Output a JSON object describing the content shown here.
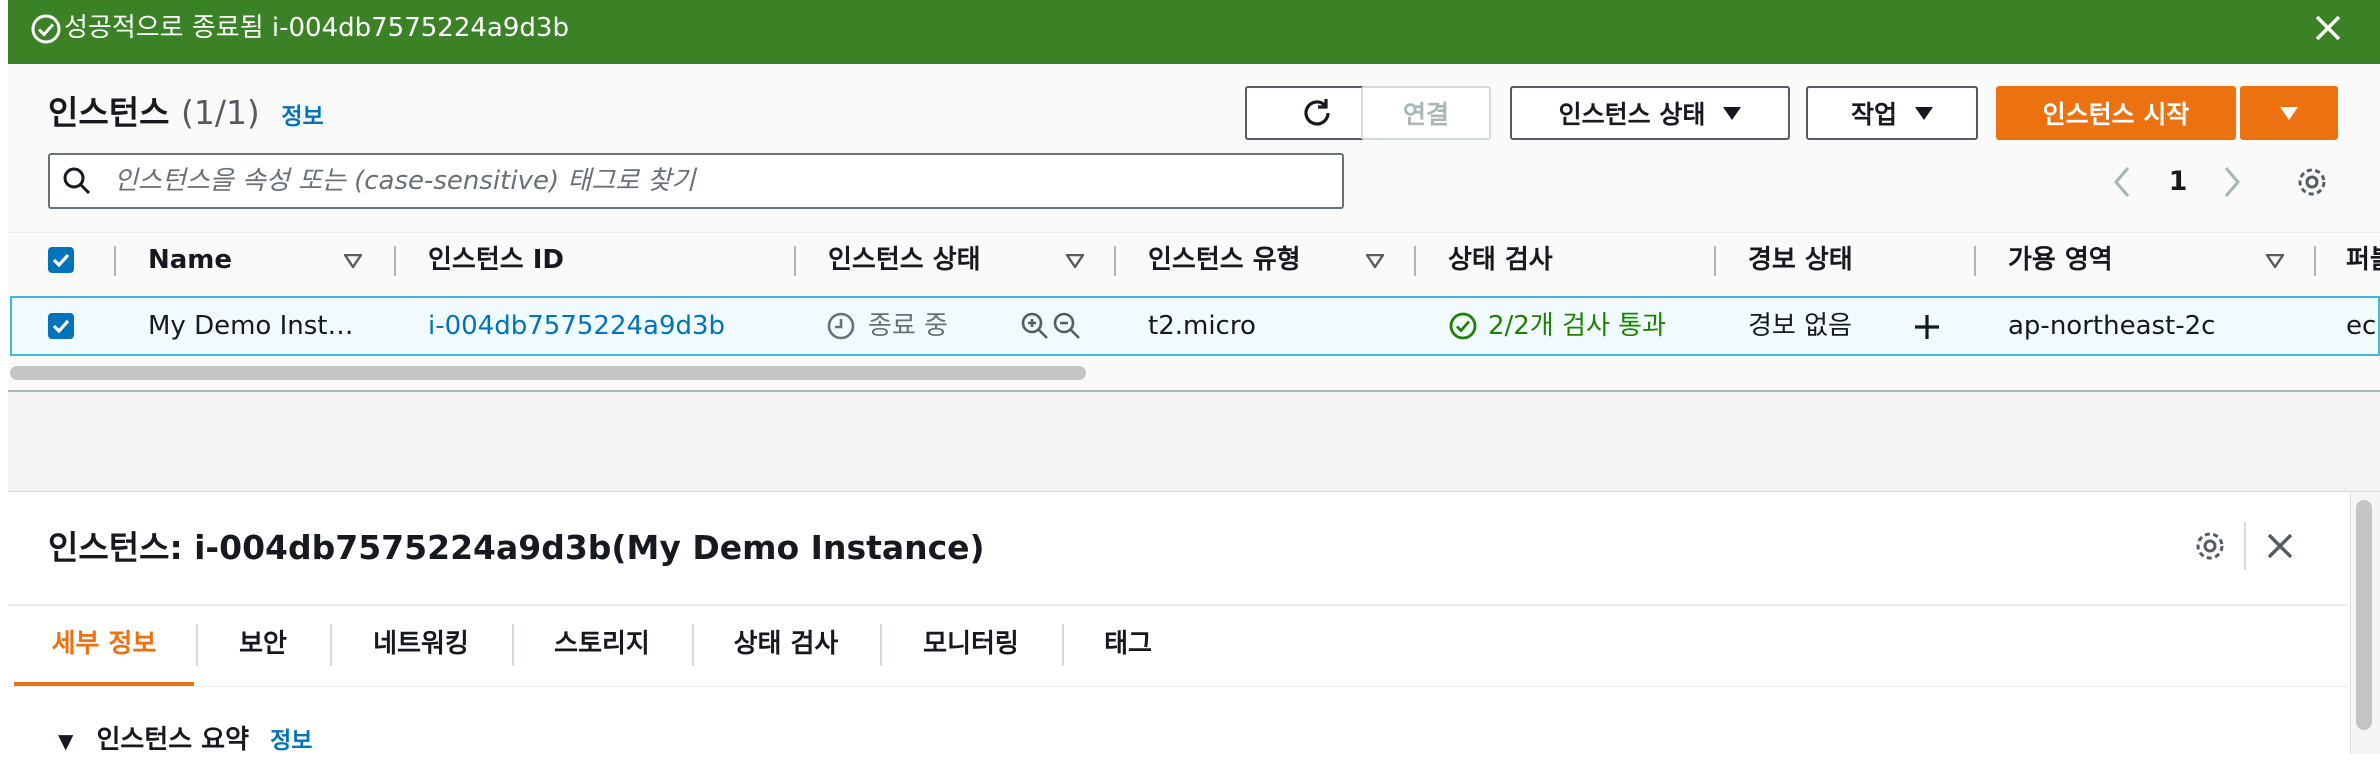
{
  "flash": {
    "message": "성공적으로 종료됨 i-004db7575224a9d3b",
    "bg_color": "#3b8226"
  },
  "instances_panel": {
    "title": "인스턴스",
    "count": "(1/1)",
    "info_link": "정보",
    "buttons": {
      "connect": "연결",
      "instance_state": "인스턴스 상태",
      "actions": "작업",
      "launch": "인스턴스 시작"
    },
    "search_placeholder": "인스턴스을 속성 또는 (case-sensitive) 태그로 찾기",
    "pagination": {
      "current_page": "1"
    },
    "accent_color": "#ec7211"
  },
  "table": {
    "columns": [
      "Name",
      "인스턴스 ID",
      "인스턴스 상태",
      "인스턴스 유형",
      "상태 검사",
      "경보 상태",
      "가용 영역",
      "퍼블"
    ],
    "rows": [
      {
        "selected": true,
        "name": "My Demo Inst…",
        "instance_id": "i-004db7575224a9d3b",
        "state": "종료 중",
        "type": "t2.micro",
        "status_check": "2/2개 검사 통과",
        "alarm_status": "경보 없음",
        "availability_zone": "ap-northeast-2c",
        "public_dns": "ec"
      }
    ]
  },
  "details": {
    "title": "인스턴스: i-004db7575224a9d3b(My Demo Instance)",
    "tabs": [
      "세부 정보",
      "보안",
      "네트워킹",
      "스토리지",
      "상태 검사",
      "모니터링",
      "태그"
    ],
    "active_tab": "세부 정보",
    "section_title": "인스턴스 요약",
    "section_info_link": "정보"
  }
}
